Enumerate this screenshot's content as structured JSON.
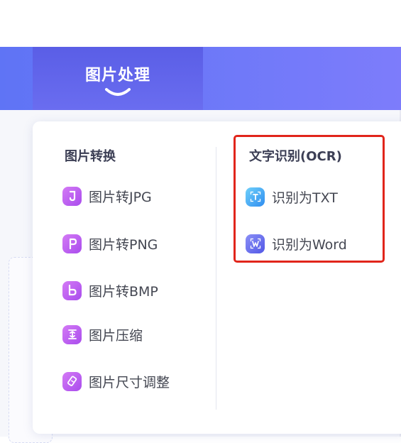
{
  "nav": {
    "active_tab": "图片处理"
  },
  "dropdown": {
    "image_convert": {
      "title": "图片转换",
      "items": [
        {
          "label": "图片转JPG",
          "icon": "jpg-icon",
          "glyph": "J"
        },
        {
          "label": "图片转PNG",
          "icon": "png-icon",
          "glyph": "P"
        },
        {
          "label": "图片转BMP",
          "icon": "bmp-icon",
          "glyph": "b"
        },
        {
          "label": "图片压缩",
          "icon": "compress-icon",
          "glyph": ""
        },
        {
          "label": "图片尺寸调整",
          "icon": "resize-icon",
          "glyph": ""
        }
      ]
    },
    "ocr": {
      "title": "文字识别(OCR)",
      "items": [
        {
          "label": "识别为TXT",
          "icon": "txt-icon",
          "glyph": "T"
        },
        {
          "label": "识别为Word",
          "icon": "word-icon",
          "glyph": "W"
        }
      ]
    }
  },
  "colors": {
    "nav_start": "#5f74f5",
    "nav_end": "#7d7cfb",
    "active_tab": "#5a5ee6",
    "purple_icon": "#b45af0",
    "ocr_txt_icon": "#3aa6f2",
    "ocr_word_icon": "#6a70ee",
    "highlight_border": "#e1251b"
  }
}
